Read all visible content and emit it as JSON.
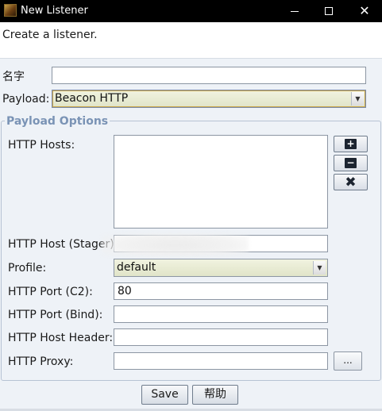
{
  "window": {
    "title": "New Listener",
    "app_icon": "cobalt-strike-icon",
    "controls": [
      "minimize-icon",
      "maximize-icon",
      "close-icon"
    ]
  },
  "description": "Create a listener.",
  "form": {
    "name_label": "名字",
    "name_value": "",
    "payload_label": "Payload:",
    "payload_value": "Beacon HTTP"
  },
  "payload_options": {
    "title": "Payload Options",
    "http_hosts_label": "HTTP Hosts:",
    "http_hosts_items": [],
    "host_buttons": [
      "add-icon",
      "remove-icon",
      "clear-icon"
    ],
    "http_host_stager_label": "HTTP Host (Stager):",
    "http_host_stager_value": "",
    "profile_label": "Profile:",
    "profile_value": "default",
    "port_c2_label": "HTTP Port (C2):",
    "port_c2_value": "80",
    "port_bind_label": "HTTP Port (Bind):",
    "port_bind_value": "",
    "host_header_label": "HTTP Host Header:",
    "host_header_value": "",
    "proxy_label": "HTTP Proxy:",
    "proxy_value": "",
    "browse_label": "..."
  },
  "buttons": {
    "save": "Save",
    "help": "帮助"
  },
  "colors": {
    "titlebar": "#000000",
    "group_title": "#7a93b5",
    "select_bg": "#e6e9d0",
    "window_bg": "#eef2f7"
  }
}
